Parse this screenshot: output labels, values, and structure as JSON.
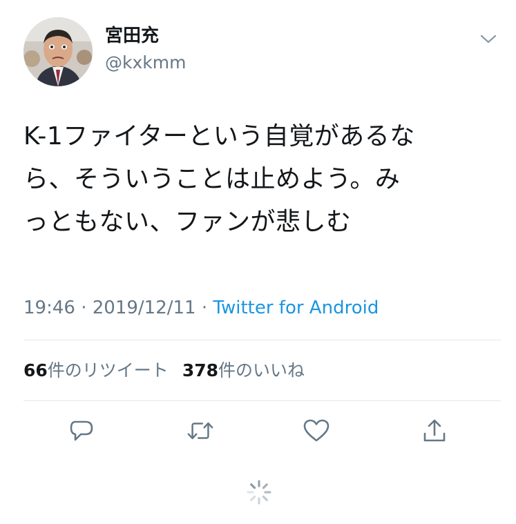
{
  "author": {
    "display_name": "宮田充",
    "handle": "@kxkmm",
    "avatar_icon": "person-photo-avatar"
  },
  "tweet": {
    "text": "K-1ファイターという自覚があるな\nら、そういうことは止めよう。み\nっともない、ファンが悲しむ"
  },
  "meta": {
    "time": "19:46",
    "separator1": " · ",
    "date": "2019/12/11",
    "separator2": " · ",
    "source": "Twitter for Android"
  },
  "stats": {
    "retweets_count": "66",
    "retweets_label": "件のリツイート",
    "likes_count": "378",
    "likes_label": "件のいいね"
  },
  "actions": {
    "reply_icon": "reply-icon",
    "retweet_icon": "retweet-icon",
    "like_icon": "heart-icon",
    "share_icon": "share-icon"
  },
  "colors": {
    "text": "#14171a",
    "secondary": "#657786",
    "link": "#1b95e0",
    "divider": "#e1e8ed",
    "icon": "#657786"
  }
}
